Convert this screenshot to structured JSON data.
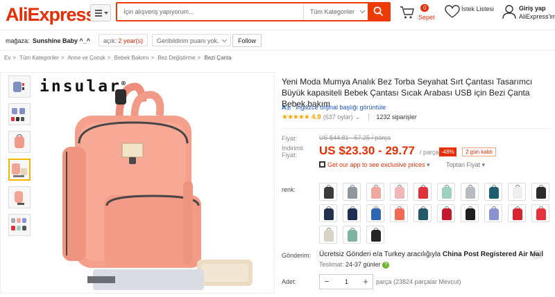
{
  "header": {
    "logo": "AliExpress",
    "search_placeholder": "İçin alışveriş yapıyorum...",
    "category": "Tüm Kategoriler",
    "cart_count": "0",
    "cart_label": "Sepet",
    "wishlist_label": "İstek Listesi",
    "account_line1": "Giriş yap",
    "account_line2": "AliExpress'im",
    "accent": "#e62e04"
  },
  "store": {
    "label": "mağaza:",
    "name": "Sunshine Baby ^_^",
    "open_label": "açık:",
    "open_years": "2 year(s)",
    "feedback": "Geribildirim puanı yok.",
    "follow": "Follow"
  },
  "breadcrumb": [
    "Ev",
    "Tüm Kategoriler",
    "Anne ve Çocuk",
    "Bebek Bakımı",
    "Bez Değiştirme",
    "Bezi Çanta"
  ],
  "product": {
    "brand": "insular",
    "title": "Yeni Moda Mumya Analık Bez Torba Seyahat Sırt Çantası Tasarımcı Büyük kapasiteli Bebek Çantası Sıcak Arabası USB için Bezi Çanta Bebek bakım",
    "translate_link": "İngilizce orijinal başlığı görüntüle",
    "rating_value": "4.9",
    "reviews": "(637 oylar)",
    "orders": "1232 siparişler",
    "price_label": "Fiyat:",
    "old_price": "US $44.81 - 57.25 / parça",
    "discount_label": "İndirimli Fiyat:",
    "price": "US $23.30 - 29.77",
    "per_unit": "/ parça",
    "discount": "-48%",
    "days_left": "2 gün kaldı",
    "app_promo": "Get our app to see exclusive prices",
    "bulk_price": "Toptan Fiyat",
    "color_label": "renk:",
    "colors": [
      {
        "name": "black",
        "hex": "#3b3b3b"
      },
      {
        "name": "gray",
        "hex": "#8e959b"
      },
      {
        "name": "pink",
        "hex": "#f0a7a0"
      },
      {
        "name": "light-pink",
        "hex": "#f3b6b8"
      },
      {
        "name": "red",
        "hex": "#e0303a"
      },
      {
        "name": "mint",
        "hex": "#9fcfbf"
      },
      {
        "name": "silver",
        "hex": "#b8bcc2"
      },
      {
        "name": "teal",
        "hex": "#1d5f6e"
      },
      {
        "name": "white",
        "hex": "#eeeeee"
      },
      {
        "name": "dark",
        "hex": "#2b2b2b"
      },
      {
        "name": "navy",
        "hex": "#24324f"
      },
      {
        "name": "navy-2",
        "hex": "#1f2e54"
      },
      {
        "name": "blue",
        "hex": "#2f67b0"
      },
      {
        "name": "coral",
        "hex": "#f26a51"
      },
      {
        "name": "dark-teal",
        "hex": "#235a6a"
      },
      {
        "name": "crimson",
        "hex": "#c4182b"
      },
      {
        "name": "black-2",
        "hex": "#1e1e1e"
      },
      {
        "name": "lavender",
        "hex": "#8a93d0"
      },
      {
        "name": "red-black",
        "hex": "#d8242e"
      },
      {
        "name": "red-2",
        "hex": "#e5323c"
      },
      {
        "name": "beige",
        "hex": "#d8d3c7"
      },
      {
        "name": "sage",
        "hex": "#7eb39d"
      },
      {
        "name": "black-3",
        "hex": "#252525"
      }
    ],
    "shipping_label": "Gönderim:",
    "shipping_free": "Ücretsiz Gönderi e/a",
    "shipping_from": "Turkey aracılığıyla",
    "shipping_method": "China Post Registered Air Mail",
    "eta_label": "Teslimat:",
    "eta_value": "24-37 günler",
    "qty_label": "Adet:",
    "qty_value": "1",
    "qty_available": "parça (23824 parçalar Mevcut)"
  }
}
